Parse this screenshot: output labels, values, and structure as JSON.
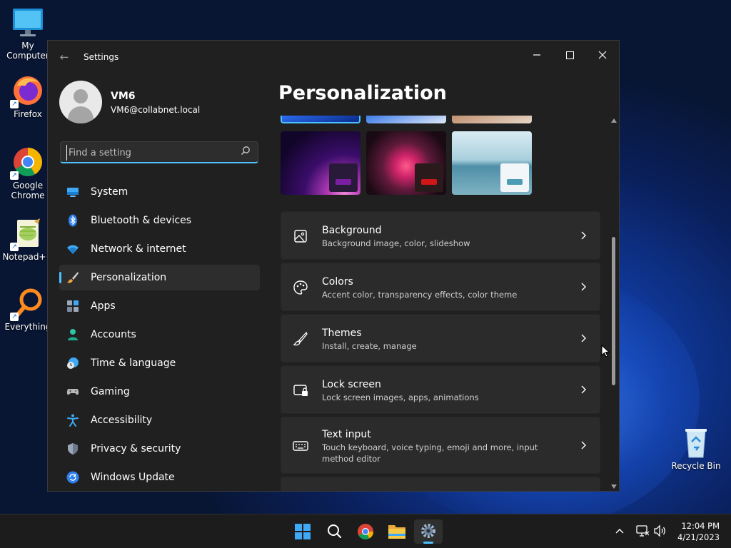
{
  "desktop": {
    "icons": [
      {
        "label": "My Computer"
      },
      {
        "label": "Firefox"
      },
      {
        "label": "Google Chrome"
      },
      {
        "label": "Notepad++"
      },
      {
        "label": "Everything"
      },
      {
        "label": "Recycle Bin"
      }
    ]
  },
  "window": {
    "title": "Settings",
    "profile": {
      "name": "VM6",
      "email": "VM6@collabnet.local"
    },
    "search": {
      "placeholder": "Find a setting"
    },
    "nav": [
      {
        "label": "System",
        "icon": "monitor-icon"
      },
      {
        "label": "Bluetooth & devices",
        "icon": "bluetooth-icon"
      },
      {
        "label": "Network & internet",
        "icon": "wifi-icon"
      },
      {
        "label": "Personalization",
        "icon": "paintbrush-icon",
        "active": true
      },
      {
        "label": "Apps",
        "icon": "apps-icon"
      },
      {
        "label": "Accounts",
        "icon": "account-icon"
      },
      {
        "label": "Time & language",
        "icon": "clock-globe-icon"
      },
      {
        "label": "Gaming",
        "icon": "gamepad-icon"
      },
      {
        "label": "Accessibility",
        "icon": "accessibility-icon"
      },
      {
        "label": "Privacy & security",
        "icon": "shield-icon"
      },
      {
        "label": "Windows Update",
        "icon": "update-icon"
      }
    ],
    "page_title": "Personalization",
    "settings": [
      {
        "title": "Background",
        "subtitle": "Background image, color, slideshow",
        "icon": "image-icon"
      },
      {
        "title": "Colors",
        "subtitle": "Accent color, transparency effects, color theme",
        "icon": "palette-icon"
      },
      {
        "title": "Themes",
        "subtitle": "Install, create, manage",
        "icon": "brush-icon"
      },
      {
        "title": "Lock screen",
        "subtitle": "Lock screen images, apps, animations",
        "icon": "lock-screen-icon"
      },
      {
        "title": "Text input",
        "subtitle": "Touch keyboard, voice typing, emoji and more, input method editor",
        "icon": "keyboard-icon"
      }
    ]
  },
  "taskbar": {
    "clock": {
      "time": "12:04 PM",
      "date": "4/21/2023"
    }
  },
  "colors": {
    "accent": "#4cc2ff",
    "window_bg": "#202020",
    "card_bg": "#2b2b2b",
    "taskbar_bg": "#1c1c1c"
  }
}
